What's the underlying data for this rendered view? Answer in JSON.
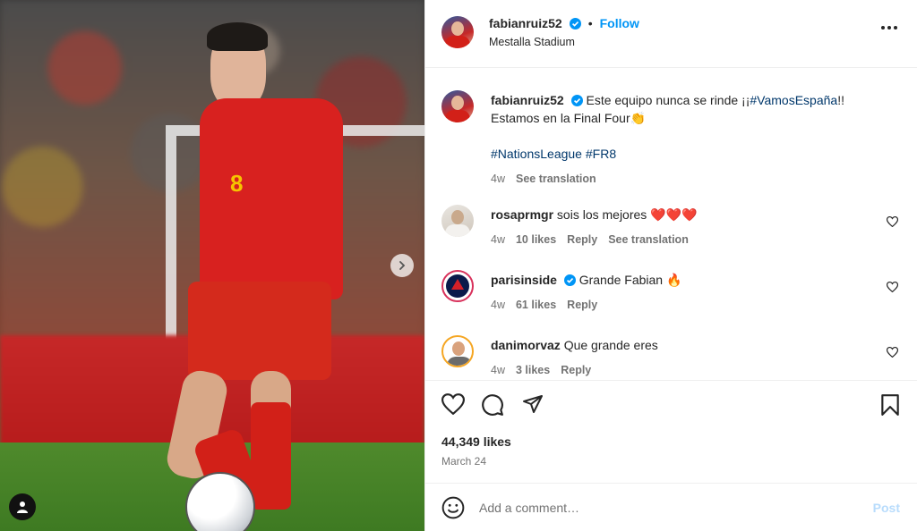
{
  "post": {
    "username": "fabianruiz52",
    "follow_label": "Follow",
    "separator": "•",
    "location": "Mestalla Stadium",
    "caption_line1": "Este equipo nunca se rinde ¡¡",
    "caption_tag1": "#VamosEspaña",
    "caption_line1_end": "!!",
    "caption_line2": "Estamos en la Final Four👏",
    "caption_tags": [
      "#NationsLeague",
      "#FR8"
    ],
    "caption_age": "4w",
    "caption_translate": "See translation",
    "shirt_number": "8"
  },
  "comments": [
    {
      "username": "rosaprmgr",
      "text": "sois los mejores ❤️❤️❤️",
      "age": "4w",
      "likes": "10 likes",
      "reply": "Reply",
      "translate": "See translation",
      "verified": false
    },
    {
      "username": "parisinside",
      "text": "Grande Fabian 🔥",
      "age": "4w",
      "likes": "61 likes",
      "reply": "Reply",
      "verified": true
    },
    {
      "username": "danimorvaz",
      "text": "Que grande eres",
      "age": "4w",
      "likes": "3 likes",
      "reply": "Reply",
      "verified": false
    }
  ],
  "actions": {
    "likes_count": "44,349 likes",
    "date": "March 24"
  },
  "add_comment": {
    "placeholder": "Add a comment…",
    "post_label": "Post"
  },
  "colors": {
    "accent": "#0095f6",
    "hashtag": "#00376b",
    "muted": "#737373"
  },
  "icons": [
    "verified-badge-icon",
    "more-options-icon",
    "heart-icon",
    "comment-icon",
    "share-icon",
    "bookmark-icon",
    "emoji-icon",
    "chevron-right-icon",
    "user-tag-icon"
  ]
}
